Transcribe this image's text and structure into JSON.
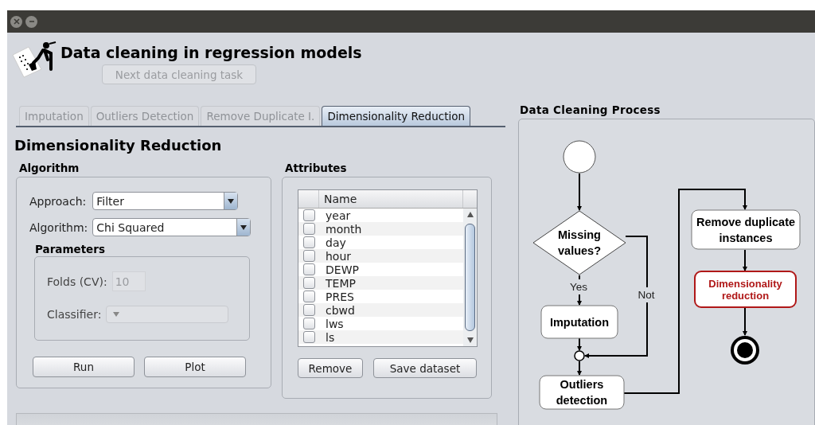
{
  "window": {
    "buttons": [
      {
        "kind": "close"
      },
      {
        "kind": "minimize"
      }
    ]
  },
  "header": {
    "title": "Data cleaning in regression models",
    "next_button": {
      "label": "Next data cleaning task",
      "disabled": true
    }
  },
  "tabs": [
    {
      "label": "Imputation",
      "selected": false
    },
    {
      "label": "Outliers Detection",
      "selected": false
    },
    {
      "label": "Remove Duplicate I.",
      "selected": false
    },
    {
      "label": "Dimensionality Reduction",
      "selected": true
    }
  ],
  "section_title": "Dimensionality Reduction",
  "algorithm": {
    "title": "Algorithm",
    "fields": [
      {
        "label": "Approach:",
        "value": "Filter"
      },
      {
        "label": "Algorithm:",
        "value": "Chi Squared"
      }
    ],
    "parameters": {
      "title": "Parameters",
      "folds": {
        "label": "Folds (CV):",
        "value": "10",
        "disabled": true
      },
      "classifier": {
        "label": "Classifier:",
        "disabled": true
      }
    },
    "buttons": [
      "Run",
      "Plot"
    ]
  },
  "attributes": {
    "title": "Attributes",
    "columns": [
      "Name"
    ],
    "rows": [
      {
        "name": "year",
        "checked": false
      },
      {
        "name": "month",
        "checked": false
      },
      {
        "name": "day",
        "checked": false
      },
      {
        "name": "hour",
        "checked": false
      },
      {
        "name": "DEWP",
        "checked": false
      },
      {
        "name": "TEMP",
        "checked": false
      },
      {
        "name": "PRES",
        "checked": false
      },
      {
        "name": "cbwd",
        "checked": false
      },
      {
        "name": "lws",
        "checked": false
      },
      {
        "name": "ls",
        "checked": false
      }
    ],
    "buttons": [
      "Remove",
      "Save dataset"
    ]
  },
  "process": {
    "title": "Data Cleaning Process",
    "nodes": [
      {
        "kind": "start"
      },
      {
        "kind": "decision",
        "lines": [
          "Missing",
          "values?"
        ]
      },
      {
        "kind": "task",
        "lines": [
          "Imputation"
        ],
        "highlighted": false
      },
      {
        "kind": "merge"
      },
      {
        "kind": "task",
        "lines": [
          "Outliers",
          "detection"
        ],
        "highlighted": false
      },
      {
        "kind": "task",
        "lines": [
          "Remove duplicate",
          "instances"
        ],
        "highlighted": false
      },
      {
        "kind": "task",
        "lines": [
          "Dimensionality",
          "reduction"
        ],
        "highlighted": true
      },
      {
        "kind": "end"
      }
    ],
    "edge_labels": [
      "Yes",
      "Not"
    ]
  }
}
